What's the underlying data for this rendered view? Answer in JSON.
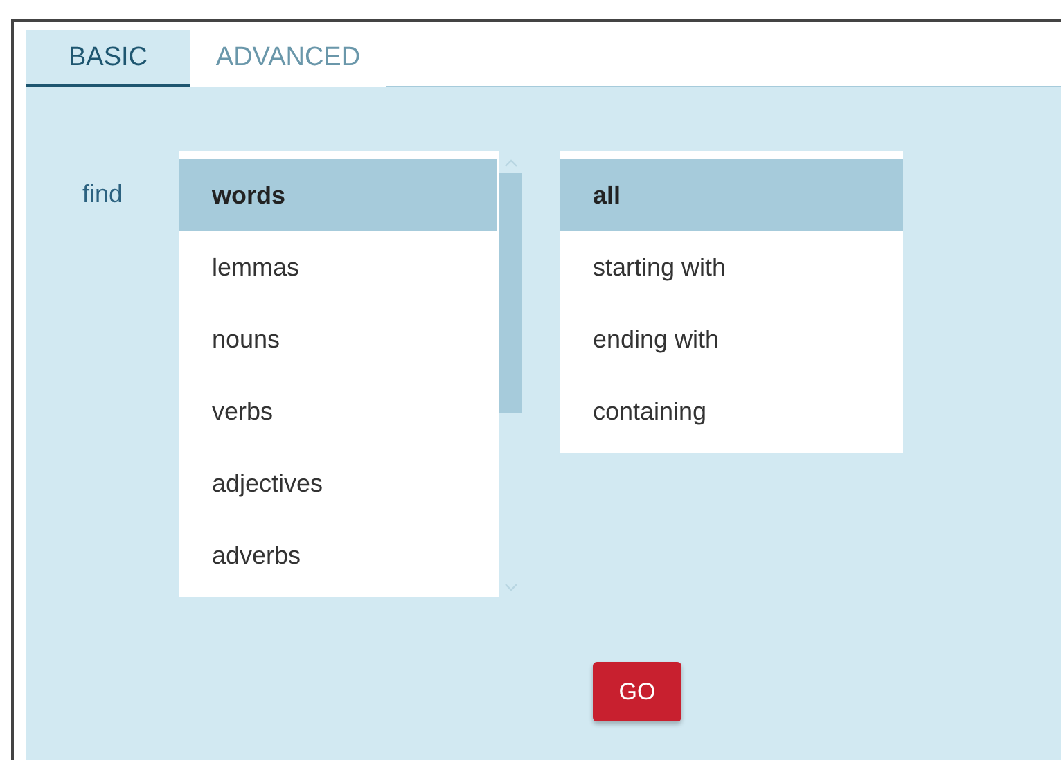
{
  "tabs": [
    {
      "label": "BASIC",
      "selected": true
    },
    {
      "label": "ADVANCED",
      "selected": false
    }
  ],
  "find_label": "find",
  "target_list": [
    {
      "label": "words",
      "selected": true
    },
    {
      "label": "lemmas",
      "selected": false
    },
    {
      "label": "nouns",
      "selected": false
    },
    {
      "label": "verbs",
      "selected": false
    },
    {
      "label": "adjectives",
      "selected": false
    },
    {
      "label": "adverbs",
      "selected": false
    }
  ],
  "match_list": [
    {
      "label": "all",
      "selected": true
    },
    {
      "label": "starting with",
      "selected": false
    },
    {
      "label": "ending with",
      "selected": false
    },
    {
      "label": "containing",
      "selected": false
    }
  ],
  "go_button": "GO"
}
